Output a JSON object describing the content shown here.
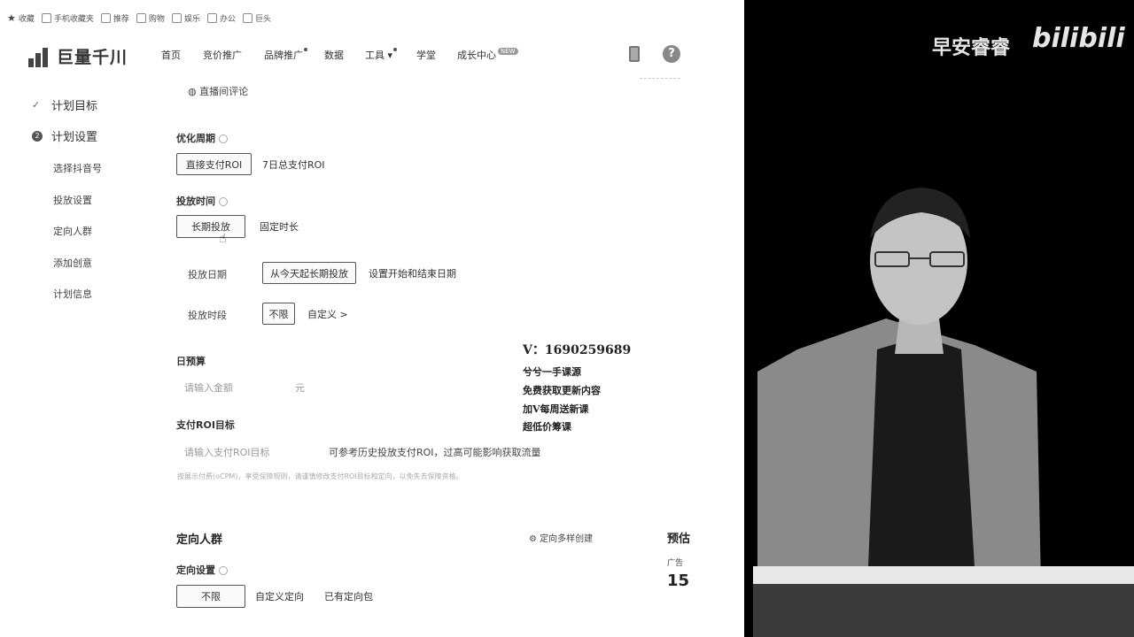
{
  "bookmarks": [
    "收藏",
    "手机收藏夹",
    "推荐",
    "购物",
    "娱乐",
    "办公",
    "巨头"
  ],
  "brand": {
    "name": "巨量千川"
  },
  "nav": [
    "首页",
    "竞价推广",
    "品牌推广",
    "数据",
    "工具",
    "学堂",
    "成长中心"
  ],
  "nav_badge": "NEW",
  "sidebar": {
    "steps": [
      {
        "label": "计划目标",
        "state": "done"
      },
      {
        "label": "计划设置",
        "state": "current",
        "num": "2"
      }
    ],
    "subs": [
      "选择抖音号",
      "投放设置",
      "定向人群",
      "添加创意",
      "计划信息"
    ]
  },
  "form": {
    "live_comment": "直播间评论",
    "opt_cycle": {
      "label": "优化周期",
      "options": [
        "直接支付ROI",
        "7日总支付ROI"
      ],
      "selected": 0
    },
    "schedule": {
      "label": "投放时间",
      "options": [
        "长期投放",
        "固定时长"
      ],
      "selected": 0
    },
    "date": {
      "label": "投放日期",
      "selected": "从今天起长期投放",
      "other": "设置开始和结束日期"
    },
    "period": {
      "label": "投放时段",
      "selected": "不限",
      "custom": "自定义 >"
    },
    "budget": {
      "label": "日预算",
      "placeholder": "请输入金额",
      "unit": "元"
    },
    "roi": {
      "label": "支付ROI目标",
      "placeholder": "请输入支付ROI目标",
      "hint": "可参考历史投放支付ROI，过高可能影响获取流量"
    },
    "note": "按展示付费(oCPM)，享受保障规则，请谨慎修改支付ROI目标和定向，以免失去保障资格。"
  },
  "targeting": {
    "title": "定向人群",
    "multi": "定向多样创建",
    "label": "定向设置",
    "options": [
      "不限",
      "自定义定向",
      "已有定向包"
    ],
    "selected": 0
  },
  "right_peek": {
    "title": "预估",
    "sub": "广告",
    "num": "15"
  },
  "promo": {
    "contact": "V：1690259689",
    "lines": [
      "兮兮一手课源",
      "免费获取更新内容",
      "加V每周送新课",
      "超低价筹课"
    ]
  },
  "watermark": {
    "text": "早安睿睿",
    "logo": "bilibili"
  }
}
